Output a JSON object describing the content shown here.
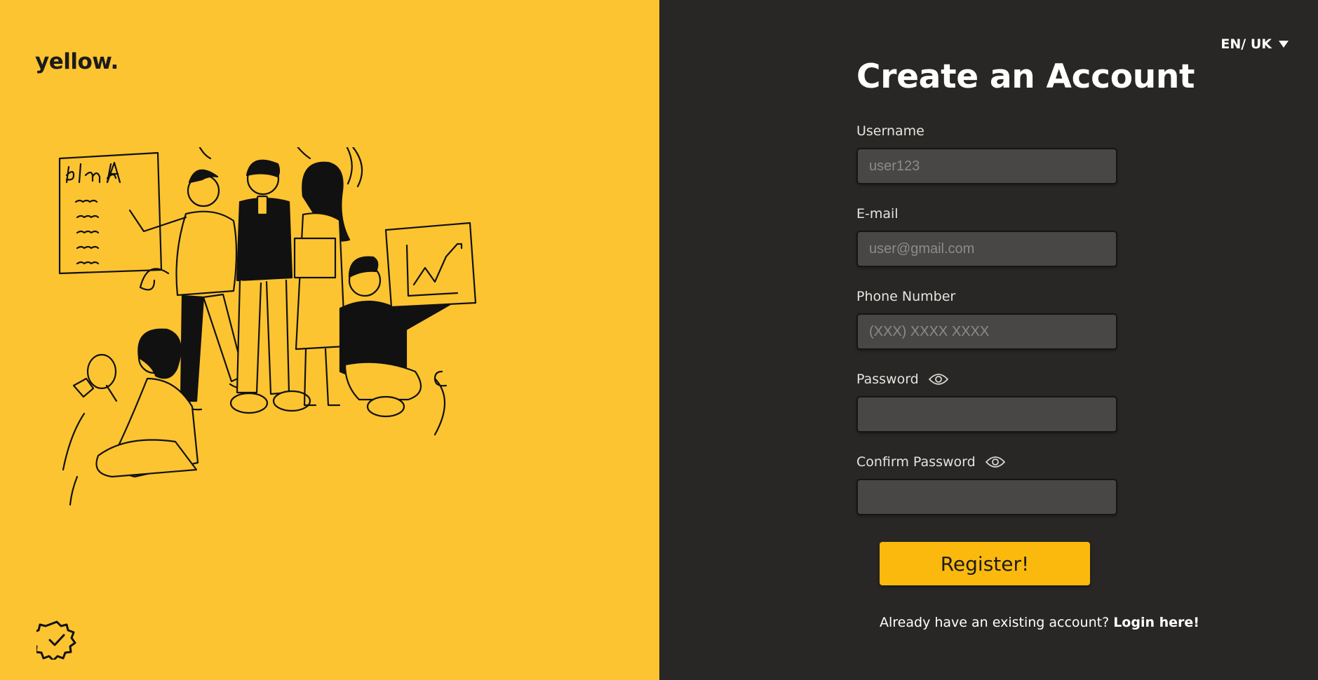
{
  "brand": {
    "logo_text": "yellow."
  },
  "language": {
    "label": "EN/ UK"
  },
  "form": {
    "title": "Create an Account",
    "username": {
      "label": "Username",
      "placeholder": "user123",
      "value": ""
    },
    "email": {
      "label": "E-mail",
      "placeholder": "user@gmail.com",
      "value": ""
    },
    "phone": {
      "label": "Phone Number",
      "placeholder": "(XXX) XXXX XXXX",
      "value": ""
    },
    "password": {
      "label": "Password",
      "placeholder": "",
      "value": ""
    },
    "confirm_password": {
      "label": "Confirm Password",
      "placeholder": "",
      "value": ""
    },
    "submit_label": "Register!"
  },
  "footer": {
    "prompt": "Already have an existing account?",
    "login_link": "Login here!"
  },
  "icons": {
    "password_toggle": "eye-icon",
    "confirm_toggle": "eye-icon",
    "language_caret": "caret-down-icon",
    "badge": "verified-badge-icon"
  },
  "colors": {
    "left_panel": "#fdc431",
    "right_panel": "#282725",
    "input_bg": "#484745",
    "button": "#fbb90e"
  }
}
